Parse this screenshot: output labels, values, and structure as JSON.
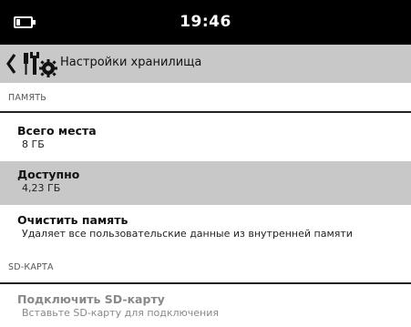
{
  "status_bar": {
    "time": "19:46"
  },
  "header": {
    "title": "Настройки хранилища"
  },
  "sections": {
    "memory": {
      "header": "ПАМЯТЬ",
      "total": {
        "title": "Всего места",
        "value": "8 ГБ"
      },
      "available": {
        "title": "Доступно",
        "value": "4,23 ГБ"
      },
      "clear": {
        "title": "Очистить память",
        "subtitle": "Удаляет все пользовательские данные из внутренней памяти"
      }
    },
    "sd": {
      "header": "SD-КАРТА",
      "mount": {
        "title": "Подключить SD-карту",
        "subtitle": "Вставьте SD-карту для подключения"
      }
    }
  }
}
